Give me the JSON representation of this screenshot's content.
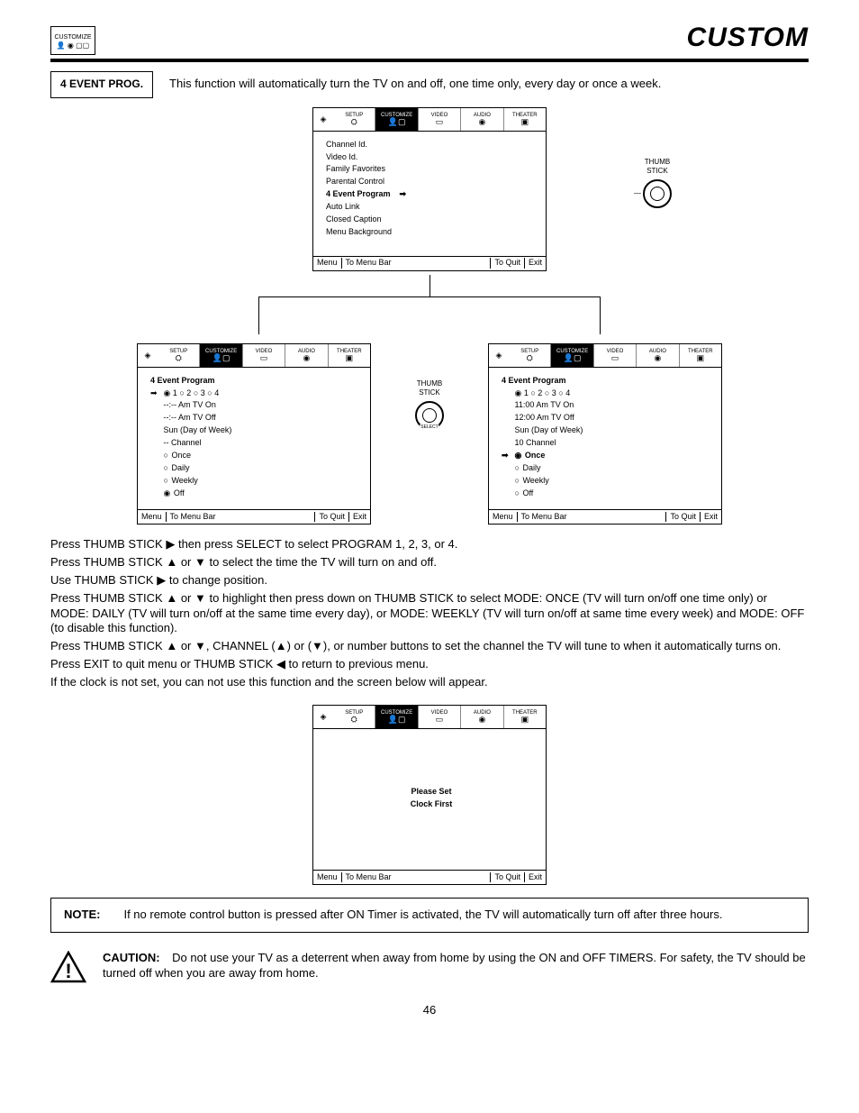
{
  "header": {
    "chip": "CUSTOMIZE",
    "title": "CUSTOM"
  },
  "section": {
    "label": "4 EVENT PROG.",
    "desc": "This function will automatically turn the TV on and off, one time only, every day or once a week."
  },
  "tabs": {
    "setup": "SETUP",
    "customize": "CUSTOMIZE",
    "video": "VIDEO",
    "audio": "AUDIO",
    "theater": "THEATER"
  },
  "osd1": {
    "l1": "Channel Id.",
    "l2": "Video Id.",
    "l3": "Family Favorites",
    "l4": "Parental Control",
    "l5": "4 Event Program",
    "l6": "Auto Link",
    "l7": "Closed Caption",
    "l8": "Menu Background"
  },
  "osd2": {
    "title": "4 Event Program",
    "nums": "◉ 1  ○ 2  ○ 3  ○ 4",
    "l1": "--:--  Am TV On",
    "l2": "--:--  Am TV Off",
    "l3": "Sun (Day of Week)",
    "l4": "-- Channel",
    "o1": "Once",
    "o2": "Daily",
    "o3": "Weekly",
    "o4": "Off"
  },
  "osd3": {
    "title": "4 Event Program",
    "nums": "◉ 1  ○ 2  ○ 3  ○ 4",
    "l1": "11:00  Am TV On",
    "l2": "12:00  Am TV Off",
    "l3": "Sun (Day of Week)",
    "l4": "10 Channel",
    "o1": "Once",
    "o2": "Daily",
    "o3": "Weekly",
    "o4": "Off"
  },
  "osd4": {
    "msg1": "Please Set",
    "msg2": "Clock First"
  },
  "osdFoot": {
    "menu": "Menu",
    "toMenuBar": "To Menu Bar",
    "toQuit": "To Quit",
    "exit": "Exit"
  },
  "thumb": "THUMB\nSTICK",
  "instructions": {
    "p1_a": "Press THUMB STICK ",
    "p1_b": " then press SELECT to select PROGRAM 1, 2, 3, or 4.",
    "p2_a": "Press THUMB STICK ",
    "p2_b": " or ",
    "p2_c": " to select the time the TV will turn on and off.",
    "p3_a": "Use THUMB STICK ",
    "p3_b": " to change position.",
    "p4_a": "Press THUMB STICK ",
    "p4_b": " or ",
    "p4_c": " to highlight then press down on THUMB STICK to select MODE: ONCE (TV will turn on/off one time only) or MODE: DAILY (TV will turn on/off at the same time every day), or MODE: WEEKLY (TV will turn on/off at same time every week) and MODE: OFF (to disable this function).",
    "p5_a": "Press THUMB STICK ",
    "p5_b": " or ",
    "p5_c": ", CHANNEL (",
    "p5_d": ") or (",
    "p5_e": "), or number buttons to set the channel the TV will tune to when it automatically turns on.",
    "p6_a": "Press EXIT to quit menu or THUMB STICK ",
    "p6_b": " to return to previous menu.",
    "p7": "If the clock is not set, you can not use this function and the screen below will appear."
  },
  "note": {
    "label": "NOTE:",
    "text": "If no remote control button is pressed after ON Timer is activated, the TV will automatically turn off after three hours."
  },
  "caution": {
    "label": "CAUTION:",
    "text": "Do not use your TV as a deterrent when away from home by using the ON and OFF TIMERS.  For safety, the TV should be turned off when you are away from home."
  },
  "pageNum": "46",
  "glyphs": {
    "right": "▶",
    "left": "◀",
    "up": "▲",
    "down": "▼",
    "radio_off": "○",
    "radio_on": "◉",
    "arrow_right": "➡"
  }
}
